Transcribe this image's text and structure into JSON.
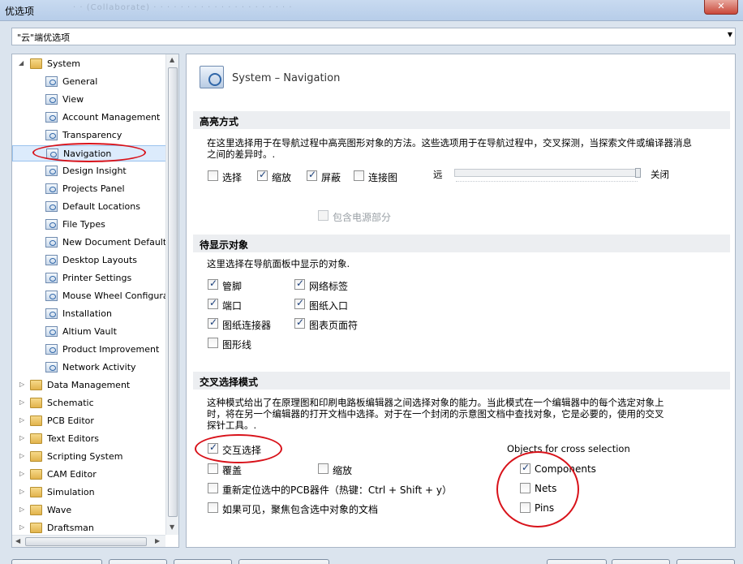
{
  "window": {
    "title": "优选项",
    "blurred_text": "· · (Collaborate) · · · · · · · · · · · · · · · · · · · · ·",
    "close_label": "✕"
  },
  "combo": {
    "value": "\"云\"端优选项"
  },
  "tree": {
    "system_label": "System",
    "system_children": [
      "General",
      "View",
      "Account Management",
      "Transparency",
      "Navigation",
      "Design Insight",
      "Projects Panel",
      "Default Locations",
      "File Types",
      "New Document Defaults",
      "Desktop Layouts",
      "Printer Settings",
      "Mouse Wheel Configura",
      "Installation",
      "Altium Vault",
      "Product Improvement",
      "Network Activity"
    ],
    "folders": [
      "Data Management",
      "Schematic",
      "PCB Editor",
      "Text Editors",
      "Scripting System",
      "CAM Editor",
      "Simulation",
      "Wave",
      "Draftsman"
    ],
    "selected": "Navigation"
  },
  "panel": {
    "title": "System – Navigation",
    "highlight": {
      "heading": "高亮方式",
      "desc1": "在这里选择用于在导航过程中高亮图形对象的方法。这些选项用于在导航过程中，交叉探测，当探索文件或编译器消息",
      "desc2": "之间的差异时。.",
      "options": [
        {
          "label": "选择",
          "checked": false
        },
        {
          "label": "缩放",
          "checked": true
        },
        {
          "label": "屏蔽",
          "checked": true
        },
        {
          "label": "连接图",
          "checked": false
        }
      ],
      "slider_left": "远",
      "slider_right": "关闭",
      "slider_value": 1.0,
      "power_label": "包含电源部分"
    },
    "objects": {
      "heading": "待显示对象",
      "desc": "这里选择在导航面板中显示的对象.",
      "items": [
        {
          "label": "管脚",
          "checked": true
        },
        {
          "label": "网络标签",
          "checked": true
        },
        {
          "label": "端口",
          "checked": true
        },
        {
          "label": "图纸入口",
          "checked": true
        },
        {
          "label": "图纸连接器",
          "checked": true
        },
        {
          "label": "图表页面符",
          "checked": true
        },
        {
          "label": "图形线",
          "checked": false
        }
      ]
    },
    "cross": {
      "heading": "交叉选择模式",
      "desc1": "这种模式给出了在原理图和印刷电路板编辑器之间选择对象的能力。当此模式在一个编辑器中的每个选定对象上",
      "desc2": "时，将在另一个编辑器的打开文档中选择。对于在一个封闭的示意图文档中查找对象，它是必要的，使用的交叉",
      "desc3": "探针工具。.",
      "cross_select": {
        "label": "交互选择",
        "checked": true
      },
      "cover": {
        "label": "覆盖",
        "checked": false
      },
      "zoom": {
        "label": "缩放",
        "checked": false
      },
      "reposition": {
        "label": "重新定位选中的PCB器件（热键：Ctrl + Shift + y）",
        "checked": false
      },
      "focus": {
        "label": "如果可见，聚焦包含选中对象的文档",
        "checked": false
      },
      "objects_title": "Objects for cross selection",
      "components": {
        "label": "Components",
        "checked": true
      },
      "nets": {
        "label": "Nets",
        "checked": false
      },
      "pins": {
        "label": "Pins",
        "checked": false
      }
    }
  },
  "colors": {
    "annotation": "#d8121a",
    "selection": "#dcebfc"
  }
}
